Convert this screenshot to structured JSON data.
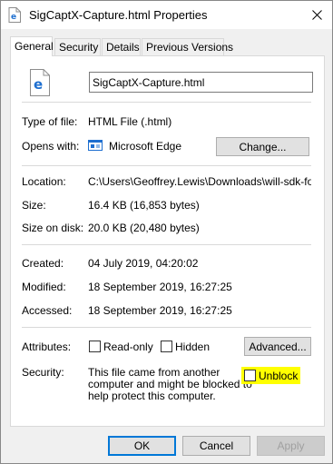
{
  "window": {
    "title": "SigCaptX-Capture.html Properties",
    "close_glyph": "✕"
  },
  "tabs": [
    {
      "label": "General",
      "active": true
    },
    {
      "label": "Security",
      "active": false
    },
    {
      "label": "Details",
      "active": false
    },
    {
      "label": "Previous Versions",
      "active": false
    }
  ],
  "file": {
    "name": "SigCaptX-Capture.html",
    "type_label": "Type of file:",
    "type_value": "HTML File (.html)",
    "opens_label": "Opens with:",
    "opens_value": "Microsoft Edge",
    "change_button": "Change...",
    "location_label": "Location:",
    "location_value": "C:\\Users\\Geoffrey.Lewis\\Downloads\\will-sdk-for-sign",
    "size_label": "Size:",
    "size_value": "16.4 KB (16,853 bytes)",
    "size_on_disk_label": "Size on disk:",
    "size_on_disk_value": "20.0 KB (20,480 bytes)",
    "created_label": "Created:",
    "created_value": "04 July 2019, 04:20:02",
    "modified_label": "Modified:",
    "modified_value": "18 September 2019, 16:27:25",
    "accessed_label": "Accessed:",
    "accessed_value": "18 September 2019, 16:27:25"
  },
  "attributes": {
    "label": "Attributes:",
    "readonly_label": "Read-only",
    "readonly_checked": false,
    "hidden_label": "Hidden",
    "hidden_checked": false,
    "advanced_button": "Advanced..."
  },
  "security": {
    "label": "Security:",
    "line1": "This file came from another",
    "line2": "computer and might be blocked to",
    "line3": "help protect this computer.",
    "unblock_label": "Unblock",
    "unblock_checked": false,
    "highlight_color": "#ffff00"
  },
  "footer": {
    "ok": "OK",
    "cancel": "Cancel",
    "apply": "Apply",
    "apply_enabled": false
  },
  "colors": {
    "edge_blue": "#1e6fd0",
    "focus_blue": "#0078d7"
  }
}
